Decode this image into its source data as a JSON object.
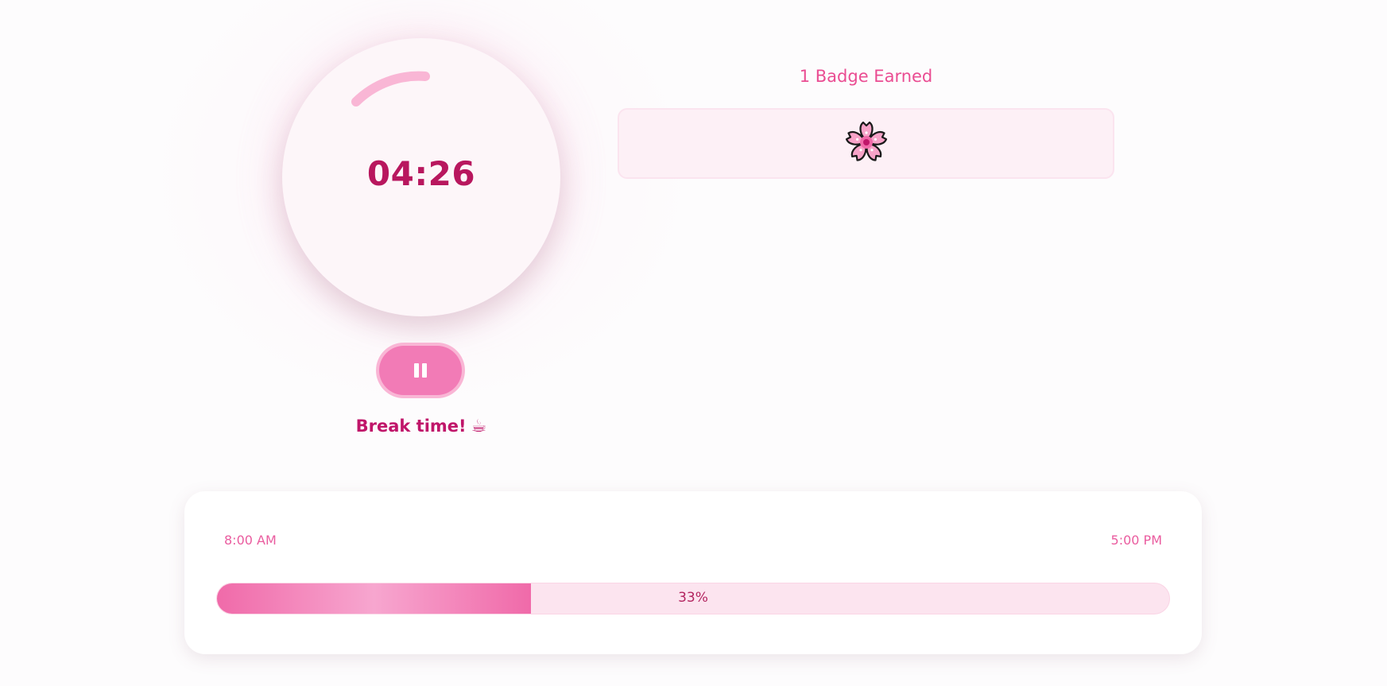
{
  "timer": {
    "time": "04:26",
    "arc_color": "#f9b6d5"
  },
  "controls": {
    "pause_icon": "pause-icon"
  },
  "status": {
    "message": "Break time!",
    "icon": "coffee-icon",
    "emoji": "☕"
  },
  "badges": {
    "title": "1 Badge Earned",
    "items": [
      {
        "icon": "cherry-blossom-icon"
      }
    ]
  },
  "timeline": {
    "start_label": "8:00 AM",
    "end_label": "5:00 PM",
    "progress_label": "33%",
    "progress_fraction": 0.33
  },
  "colors": {
    "accent": "#f27bb6",
    "accent_dark": "#b8175e",
    "panel_bg": "#fdf0f6"
  }
}
